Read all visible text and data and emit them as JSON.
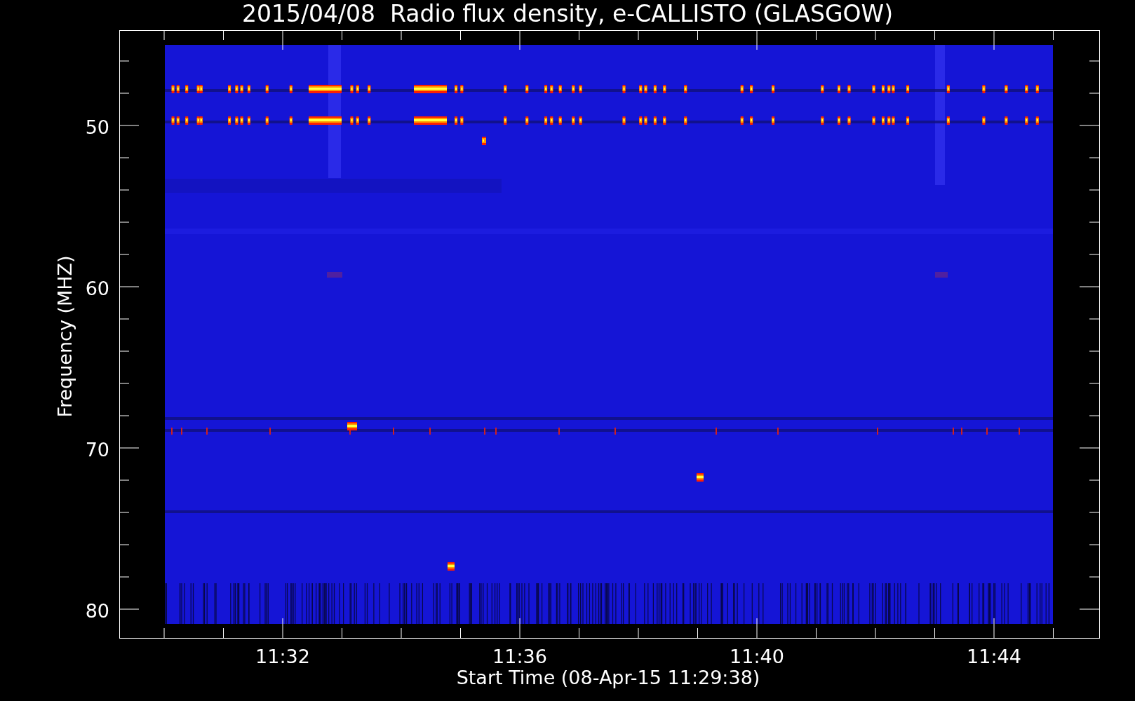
{
  "title": "2015/04/08  Radio flux density, e-CALLISTO (GLASGOW)",
  "ylabel": "Frequency (MHZ)",
  "xlabel": "Start Time (08-Apr-15 11:29:38)",
  "yticks": [
    "50",
    "60",
    "70",
    "80"
  ],
  "xticks": [
    "11:32",
    "11:36",
    "11:40",
    "11:44"
  ]
}
